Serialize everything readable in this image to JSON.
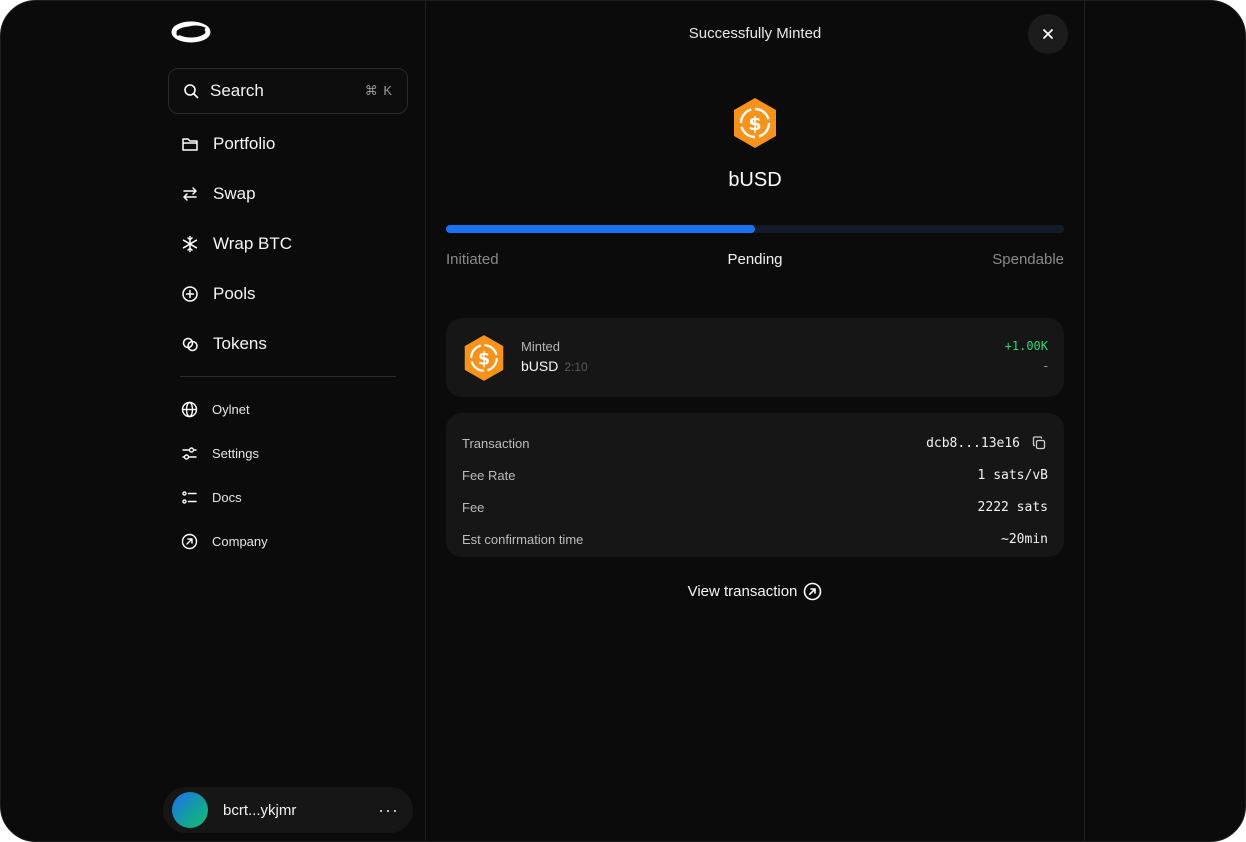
{
  "sidebar": {
    "search": {
      "label": "Search",
      "shortcut": "⌘ K"
    },
    "nav": [
      {
        "label": "Portfolio",
        "icon": "folder-icon"
      },
      {
        "label": "Swap",
        "icon": "swap-arrows-icon"
      },
      {
        "label": "Wrap BTC",
        "icon": "snowflake-icon"
      },
      {
        "label": "Pools",
        "icon": "plus-circle-icon"
      },
      {
        "label": "Tokens",
        "icon": "coins-icon"
      }
    ],
    "subnav": [
      {
        "label": "Oylnet",
        "icon": "globe-icon"
      },
      {
        "label": "Settings",
        "icon": "sliders-icon"
      },
      {
        "label": "Docs",
        "icon": "list-icon"
      },
      {
        "label": "Company",
        "icon": "arrow-up-right-circle-icon"
      }
    ],
    "account": {
      "address": "bcrt...ykjmr",
      "more": "···"
    }
  },
  "panel": {
    "title": "Successfully Minted",
    "token_name": "bUSD",
    "progress": {
      "fraction": 0.5,
      "steps": [
        "Initiated",
        "Pending",
        "Spendable"
      ]
    },
    "mint": {
      "label": "Minted",
      "token": "bUSD",
      "time": "2:10",
      "amount": "+1.00K",
      "secondary": "-"
    },
    "details": [
      {
        "label": "Transaction",
        "value": "dcb8...13e16"
      },
      {
        "label": "Fee Rate",
        "value": "1 sats/vB"
      },
      {
        "label": "Fee",
        "value": "2222 sats"
      },
      {
        "label": "Est confirmation time",
        "value": "~20min"
      }
    ],
    "view_tx_label": "View transaction"
  },
  "colors": {
    "accent_blue": "#1a73f0",
    "positive_green": "#2ed47a",
    "token_orange": "#f7931a"
  }
}
